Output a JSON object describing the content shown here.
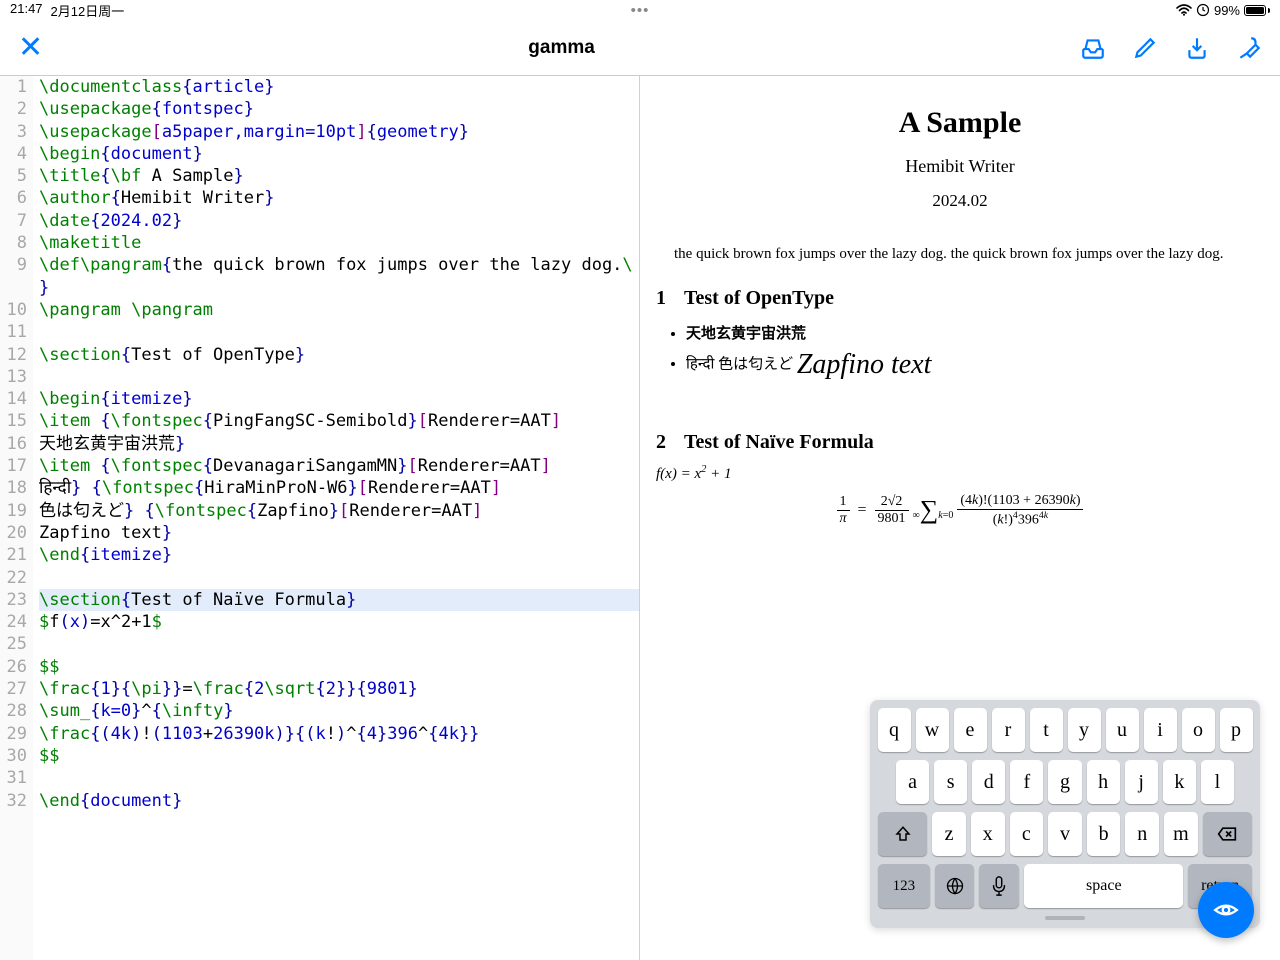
{
  "status": {
    "time": "21:47",
    "date": "2月12日周一",
    "battery": "99%"
  },
  "toolbar": {
    "title": "gamma"
  },
  "gutter_start": 1,
  "gutter_end": 32,
  "highlighted_line": 23,
  "code_lines": [
    [
      {
        "c": "cmd",
        "t": "\\documentclass"
      },
      {
        "c": "brace",
        "t": "{"
      },
      {
        "c": "keyw",
        "t": "article"
      },
      {
        "c": "brace",
        "t": "}"
      }
    ],
    [
      {
        "c": "cmd",
        "t": "\\usepackage"
      },
      {
        "c": "brace",
        "t": "{"
      },
      {
        "c": "keyw",
        "t": "fontspec"
      },
      {
        "c": "brace",
        "t": "}"
      }
    ],
    [
      {
        "c": "cmd",
        "t": "\\usepackage"
      },
      {
        "c": "opt",
        "t": "["
      },
      {
        "c": "keyw",
        "t": "a5paper,margin=10pt"
      },
      {
        "c": "opt",
        "t": "]"
      },
      {
        "c": "brace",
        "t": "{"
      },
      {
        "c": "keyw",
        "t": "geometry"
      },
      {
        "c": "brace",
        "t": "}"
      }
    ],
    [
      {
        "c": "cmd",
        "t": "\\begin"
      },
      {
        "c": "brace",
        "t": "{"
      },
      {
        "c": "keyw",
        "t": "document"
      },
      {
        "c": "brace",
        "t": "}"
      }
    ],
    [
      {
        "c": "cmd",
        "t": "\\title"
      },
      {
        "c": "brace",
        "t": "{"
      },
      {
        "c": "cmd",
        "t": "\\bf"
      },
      {
        "c": "arg",
        "t": " A Sample"
      },
      {
        "c": "brace",
        "t": "}"
      }
    ],
    [
      {
        "c": "cmd",
        "t": "\\author"
      },
      {
        "c": "brace",
        "t": "{"
      },
      {
        "c": "arg",
        "t": "Hemibit Writer"
      },
      {
        "c": "brace",
        "t": "}"
      }
    ],
    [
      {
        "c": "cmd",
        "t": "\\date"
      },
      {
        "c": "brace",
        "t": "{"
      },
      {
        "c": "keyw",
        "t": "2024.02"
      },
      {
        "c": "brace",
        "t": "}"
      }
    ],
    [
      {
        "c": "cmd",
        "t": "\\maketitle"
      }
    ],
    [
      {
        "c": "cmd",
        "t": "\\def\\pangram"
      },
      {
        "c": "brace",
        "t": "{"
      },
      {
        "c": "arg",
        "t": "the quick brown fox jumps over the lazy dog."
      },
      {
        "c": "cmd",
        "t": "\\ "
      },
      {
        "c": "brace",
        "t": "}"
      }
    ],
    [
      {
        "c": "cmd",
        "t": "\\pangram \\pangram"
      }
    ],
    [],
    [
      {
        "c": "cmd",
        "t": "\\section"
      },
      {
        "c": "brace",
        "t": "{"
      },
      {
        "c": "arg",
        "t": "Test of OpenType"
      },
      {
        "c": "brace",
        "t": "}"
      }
    ],
    [],
    [
      {
        "c": "cmd",
        "t": "\\begin"
      },
      {
        "c": "brace",
        "t": "{"
      },
      {
        "c": "keyw",
        "t": "itemize"
      },
      {
        "c": "brace",
        "t": "}"
      }
    ],
    [
      {
        "c": "cmd",
        "t": "\\item "
      },
      {
        "c": "brace",
        "t": "{"
      },
      {
        "c": "cmd",
        "t": "\\fontspec"
      },
      {
        "c": "brace",
        "t": "{"
      },
      {
        "c": "arg",
        "t": "PingFangSC-Semibold"
      },
      {
        "c": "brace",
        "t": "}"
      },
      {
        "c": "opt",
        "t": "["
      },
      {
        "c": "arg",
        "t": "Renderer=AAT"
      },
      {
        "c": "opt",
        "t": "]"
      }
    ],
    [
      {
        "c": "arg",
        "t": "天地玄黄宇宙洪荒"
      },
      {
        "c": "brace",
        "t": "}"
      }
    ],
    [
      {
        "c": "cmd",
        "t": "\\item "
      },
      {
        "c": "brace",
        "t": "{"
      },
      {
        "c": "cmd",
        "t": "\\fontspec"
      },
      {
        "c": "brace",
        "t": "{"
      },
      {
        "c": "arg",
        "t": "DevanagariSangamMN"
      },
      {
        "c": "brace",
        "t": "}"
      },
      {
        "c": "opt",
        "t": "["
      },
      {
        "c": "arg",
        "t": "Renderer=AAT"
      },
      {
        "c": "opt",
        "t": "]"
      }
    ],
    [
      {
        "c": "arg",
        "t": "हिन्दी"
      },
      {
        "c": "brace",
        "t": "}"
      },
      {
        "c": "arg",
        "t": " "
      },
      {
        "c": "brace",
        "t": "{"
      },
      {
        "c": "cmd",
        "t": "\\fontspec"
      },
      {
        "c": "brace",
        "t": "{"
      },
      {
        "c": "arg",
        "t": "HiraMinProN-W6"
      },
      {
        "c": "brace",
        "t": "}"
      },
      {
        "c": "opt",
        "t": "["
      },
      {
        "c": "arg",
        "t": "Renderer=AAT"
      },
      {
        "c": "opt",
        "t": "]"
      }
    ],
    [
      {
        "c": "arg",
        "t": "色は匂えど"
      },
      {
        "c": "brace",
        "t": "}"
      },
      {
        "c": "arg",
        "t": " "
      },
      {
        "c": "brace",
        "t": "{"
      },
      {
        "c": "cmd",
        "t": "\\fontspec"
      },
      {
        "c": "brace",
        "t": "{"
      },
      {
        "c": "arg",
        "t": "Zapfino"
      },
      {
        "c": "brace",
        "t": "}"
      },
      {
        "c": "opt",
        "t": "["
      },
      {
        "c": "arg",
        "t": "Renderer=AAT"
      },
      {
        "c": "opt",
        "t": "]"
      }
    ],
    [
      {
        "c": "arg",
        "t": "Zapfino text"
      },
      {
        "c": "brace",
        "t": "}"
      }
    ],
    [
      {
        "c": "cmd",
        "t": "\\end"
      },
      {
        "c": "brace",
        "t": "{"
      },
      {
        "c": "keyw",
        "t": "itemize"
      },
      {
        "c": "brace",
        "t": "}"
      }
    ],
    [],
    [
      {
        "c": "cmd",
        "t": "\\section"
      },
      {
        "c": "brace",
        "t": "{"
      },
      {
        "c": "arg",
        "t": "Test of Naïve Formula"
      },
      {
        "c": "brace",
        "t": "}"
      }
    ],
    [
      {
        "c": "math",
        "t": "$"
      },
      {
        "c": "arg",
        "t": "f"
      },
      {
        "c": "brace",
        "t": "("
      },
      {
        "c": "keyw",
        "t": "x"
      },
      {
        "c": "brace",
        "t": ")"
      },
      {
        "c": "arg",
        "t": "=x^2+1"
      },
      {
        "c": "math",
        "t": "$"
      }
    ],
    [],
    [
      {
        "c": "math",
        "t": "$$"
      }
    ],
    [
      {
        "c": "cmd",
        "t": "\\frac"
      },
      {
        "c": "brace",
        "t": "{"
      },
      {
        "c": "keyw",
        "t": "1"
      },
      {
        "c": "brace",
        "t": "}{"
      },
      {
        "c": "cmd",
        "t": "\\pi"
      },
      {
        "c": "brace",
        "t": "}}"
      },
      {
        "c": "arg",
        "t": "="
      },
      {
        "c": "cmd",
        "t": "\\frac"
      },
      {
        "c": "brace",
        "t": "{"
      },
      {
        "c": "keyw",
        "t": "2"
      },
      {
        "c": "cmd",
        "t": "\\sqrt"
      },
      {
        "c": "brace",
        "t": "{"
      },
      {
        "c": "keyw",
        "t": "2"
      },
      {
        "c": "brace",
        "t": "}}{"
      },
      {
        "c": "keyw",
        "t": "9801"
      },
      {
        "c": "brace",
        "t": "}"
      }
    ],
    [
      {
        "c": "cmd",
        "t": "\\sum_"
      },
      {
        "c": "brace",
        "t": "{"
      },
      {
        "c": "keyw",
        "t": "k=0"
      },
      {
        "c": "brace",
        "t": "}"
      },
      {
        "c": "arg",
        "t": "^"
      },
      {
        "c": "brace",
        "t": "{"
      },
      {
        "c": "cmd",
        "t": "\\infty"
      },
      {
        "c": "brace",
        "t": "}"
      }
    ],
    [
      {
        "c": "cmd",
        "t": "\\frac"
      },
      {
        "c": "brace",
        "t": "{("
      },
      {
        "c": "keyw",
        "t": "4k"
      },
      {
        "c": "brace",
        "t": ")"
      },
      {
        "c": "arg",
        "t": "!"
      },
      {
        "c": "brace",
        "t": "("
      },
      {
        "c": "keyw",
        "t": "1103"
      },
      {
        "c": "arg",
        "t": "+"
      },
      {
        "c": "keyw",
        "t": "26390k"
      },
      {
        "c": "brace",
        "t": ")}{("
      },
      {
        "c": "keyw",
        "t": "k"
      },
      {
        "c": "arg",
        "t": "!"
      },
      {
        "c": "brace",
        "t": ")"
      },
      {
        "c": "arg",
        "t": "^"
      },
      {
        "c": "brace",
        "t": "{"
      },
      {
        "c": "keyw",
        "t": "4"
      },
      {
        "c": "brace",
        "t": "}"
      },
      {
        "c": "keyw",
        "t": "396"
      },
      {
        "c": "arg",
        "t": "^"
      },
      {
        "c": "brace",
        "t": "{"
      },
      {
        "c": "keyw",
        "t": "4k"
      },
      {
        "c": "brace",
        "t": "}}"
      }
    ],
    [
      {
        "c": "math",
        "t": "$$"
      }
    ],
    [],
    [
      {
        "c": "cmd",
        "t": "\\end"
      },
      {
        "c": "brace",
        "t": "{"
      },
      {
        "c": "keyw",
        "t": "document"
      },
      {
        "c": "brace",
        "t": "}"
      }
    ]
  ],
  "preview": {
    "title": "A Sample",
    "author": "Hemibit Writer",
    "date": "2024.02",
    "para": "the quick brown fox jumps over the lazy dog. the quick brown fox jumps over the lazy dog.",
    "sec1_num": "1",
    "sec1_title": "Test of OpenType",
    "li1": "天地玄黄宇宙洪荒",
    "li2a": "हिन्दी 色は匂えど ",
    "li2b": "Zapfino text",
    "sec2_num": "2",
    "sec2_title": "Test of Naïve Formula",
    "formula_inline": "f(x) = x² + 1"
  },
  "keyboard": {
    "row1": [
      "q",
      "w",
      "e",
      "r",
      "t",
      "y",
      "u",
      "i",
      "o",
      "p"
    ],
    "row2": [
      "a",
      "s",
      "d",
      "f",
      "g",
      "h",
      "j",
      "k",
      "l"
    ],
    "row3": [
      "z",
      "x",
      "c",
      "v",
      "b",
      "n",
      "m"
    ],
    "num_key": "123",
    "space": "space",
    "return": "return"
  }
}
